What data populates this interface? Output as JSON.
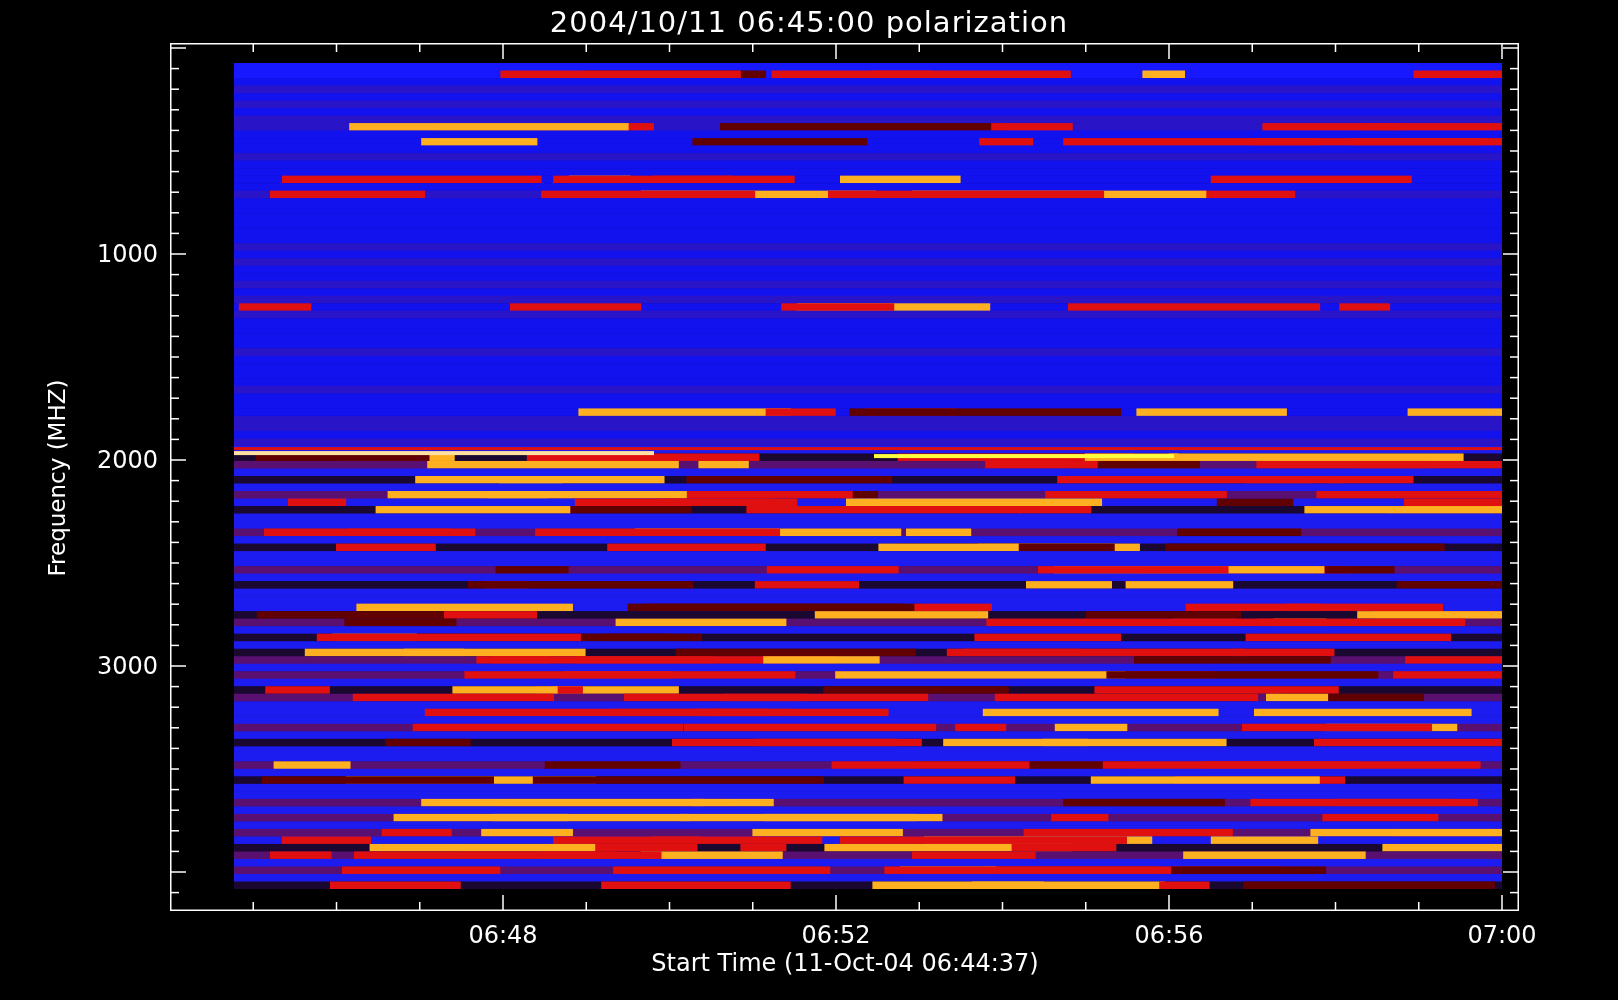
{
  "title": "2004/10/11 06:45:00 polarization",
  "y_axis": {
    "label": "Frequency (MHZ)",
    "ticks": [
      "1000",
      "2000",
      "3000"
    ]
  },
  "x_axis": {
    "label": "Start Time (11-Oct-04 06:44:37)",
    "ticks": [
      "06:48",
      "06:52",
      "06:56",
      "07:00"
    ]
  }
}
